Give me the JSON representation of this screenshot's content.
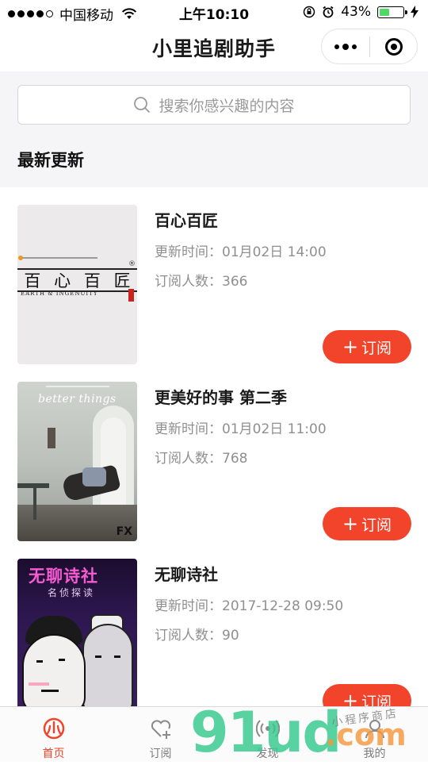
{
  "status_bar": {
    "carrier": "中国移动",
    "time": "上午10:10",
    "battery": "43%",
    "battery_level": 0.43
  },
  "nav": {
    "title": "小里追剧助手"
  },
  "search": {
    "placeholder": "搜索你感兴趣的内容"
  },
  "section": {
    "title": "最新更新"
  },
  "shows": [
    {
      "title": "百心百匠",
      "update_time": "更新时间：01月02日 14:00",
      "subscribers": "订阅人数：366",
      "button": "订阅",
      "poster_text": "百心百匠",
      "poster_en": "EARTH & INGENUITY"
    },
    {
      "title": "更美好的事 第二季",
      "update_time": "更新时间：01月02日 11:00",
      "subscribers": "订阅人数：768",
      "button": "订阅",
      "poster_text": "better things"
    },
    {
      "title": "无聊诗社",
      "update_time": "更新时间：2017-12-28 09:50",
      "subscribers": "订阅人数：90",
      "button": "订阅",
      "poster_text": "无聊诗社",
      "poster_subtext": "名侦探读"
    }
  ],
  "tabs": [
    {
      "label": "首页",
      "icon": "home-icon",
      "active": true
    },
    {
      "label": "订阅",
      "icon": "heart-plus-icon",
      "active": false
    },
    {
      "label": "发现",
      "icon": "discover-icon",
      "active": false
    },
    {
      "label": "我的",
      "icon": "user-icon",
      "active": false
    }
  ],
  "watermark": {
    "big": "91ud",
    "com": ".com",
    "small": "小程序商店"
  },
  "colors": {
    "accent": "#f2432b",
    "header_bg": "#f5f5f7",
    "meta_text": "#8f8f8f"
  }
}
